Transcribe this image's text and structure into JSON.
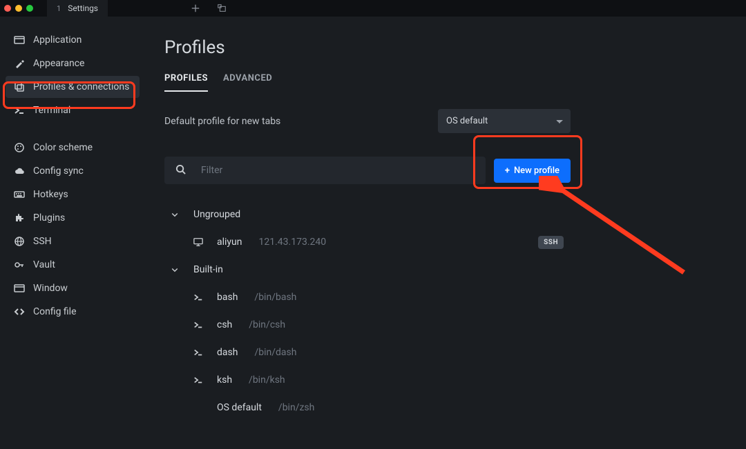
{
  "titlebar": {
    "tab_index": "1",
    "tab_name": "Settings"
  },
  "sidebar": {
    "group1": [
      {
        "id": "application",
        "label": "Application",
        "icon": "window"
      },
      {
        "id": "appearance",
        "label": "Appearance",
        "icon": "brush"
      },
      {
        "id": "profiles",
        "label": "Profiles & connections",
        "icon": "stack",
        "active": true
      },
      {
        "id": "terminal",
        "label": "Terminal",
        "icon": "prompt"
      }
    ],
    "group2": [
      {
        "id": "color-scheme",
        "label": "Color scheme",
        "icon": "palette"
      },
      {
        "id": "config-sync",
        "label": "Config sync",
        "icon": "cloud"
      },
      {
        "id": "hotkeys",
        "label": "Hotkeys",
        "icon": "keyboard"
      },
      {
        "id": "plugins",
        "label": "Plugins",
        "icon": "puzzle"
      },
      {
        "id": "ssh",
        "label": "SSH",
        "icon": "globe"
      },
      {
        "id": "vault",
        "label": "Vault",
        "icon": "key"
      },
      {
        "id": "window",
        "label": "Window",
        "icon": "window"
      },
      {
        "id": "config-file",
        "label": "Config file",
        "icon": "code"
      }
    ]
  },
  "page": {
    "title": "Profiles",
    "tabs": {
      "profiles": "PROFILES",
      "advanced": "ADVANCED"
    },
    "default_label": "Default profile for new tabs",
    "default_value": "OS default",
    "filter_placeholder": "Filter",
    "new_profile_label": "New profile"
  },
  "groups": [
    {
      "name": "Ungrouped",
      "items": [
        {
          "icon": "monitor",
          "name": "aliyun",
          "detail": "121.43.173.240",
          "badge": "SSH"
        }
      ]
    },
    {
      "name": "Built-in",
      "items": [
        {
          "icon": "prompt",
          "name": "bash",
          "detail": "/bin/bash"
        },
        {
          "icon": "prompt",
          "name": "csh",
          "detail": "/bin/csh"
        },
        {
          "icon": "prompt",
          "name": "dash",
          "detail": "/bin/dash"
        },
        {
          "icon": "prompt",
          "name": "ksh",
          "detail": "/bin/ksh"
        },
        {
          "icon": "none",
          "name": "OS default",
          "detail": "/bin/zsh"
        }
      ]
    }
  ],
  "annotation": {
    "highlights": [
      "sidebar-profiles",
      "new-profile-button"
    ],
    "arrow_color": "#ff3b1f"
  }
}
